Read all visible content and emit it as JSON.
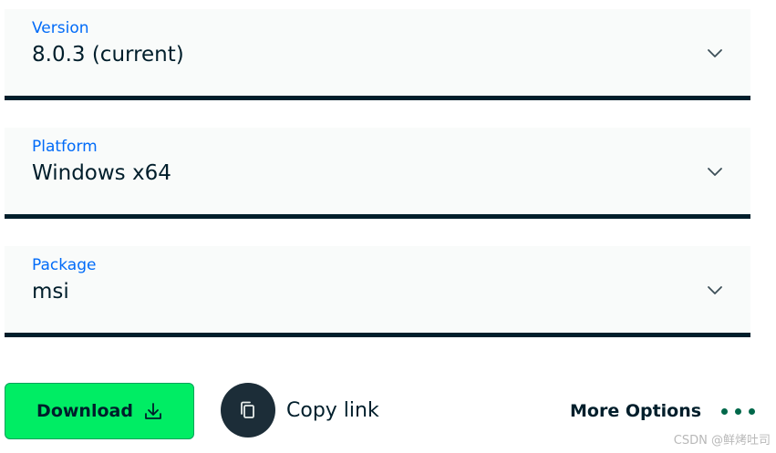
{
  "fields": [
    {
      "label": "Version",
      "value": "8.0.3 (current)"
    },
    {
      "label": "Platform",
      "value": "Windows x64"
    },
    {
      "label": "Package",
      "value": "msi"
    }
  ],
  "actions": {
    "download_label": "Download",
    "copy_link_label": "Copy link",
    "more_options_label": "More Options"
  },
  "watermark": "CSDN @鲜烤吐司",
  "colors": {
    "label_blue": "#016bf8",
    "text_dark": "#001e2b",
    "download_green": "#00ed64",
    "dots_green": "#00684a"
  },
  "icons": {
    "chevron": "chevron-down-icon",
    "download": "download-icon",
    "copy": "copy-icon",
    "more": "ellipsis-icon"
  }
}
